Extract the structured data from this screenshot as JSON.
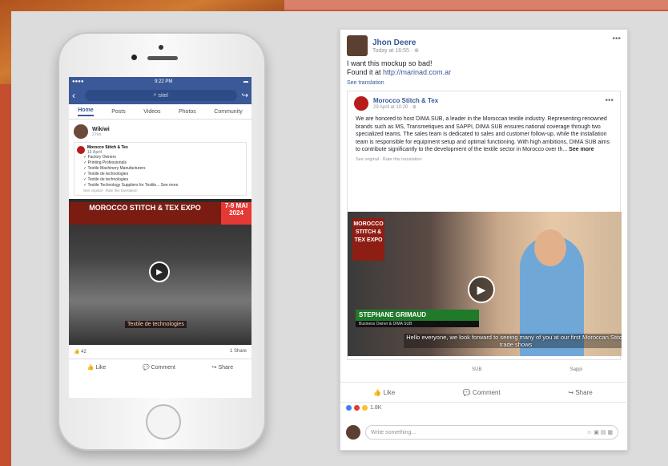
{
  "phone": {
    "status_time": "9:22 PM",
    "search_text": "sitel",
    "tabs": [
      "Home",
      "Posts",
      "Videos",
      "Photos",
      "Community"
    ],
    "post_author": "Wikiwi",
    "post_time": "2 hrs",
    "shared_author": "Morocco Stitch & Tex",
    "shared_time": "15 April",
    "list": [
      "Factory Owners",
      "Printing Professionals",
      "Textile Machinery Manufacturers",
      "Textile de technologies",
      "Textile de technologies",
      "Textile Technology Suppliers for Textile... See more"
    ],
    "see_original": "See original · Rate this translation",
    "video_banner": "MOROCCO STITCH & TEX EXPO",
    "video_date": "7-9 MAI 2024",
    "caption": "Textile de technologies",
    "likes": "42",
    "shares": "1 Share",
    "actions": [
      "Like",
      "Comment",
      "Share"
    ]
  },
  "desktop": {
    "author": "Jhon Deere",
    "time": "Today at 16:55 · ",
    "text_line1": "I want this mockup so bad!",
    "text_line2_prefix": "Found it at ",
    "text_link": "http://marinad.com.ar",
    "see_translation": "See translation",
    "shared_author": "Morocco Stitch & Tex",
    "shared_time": "29 April at 10:20 · ",
    "shared_body": "We are honored to host DIMA SUB, a leader in the Moroccan textile industry. Representing renowned brands such as MS, Transmetiques and SAPPI, DIMA SUB ensures national coverage through two specialized teams. The sales team is dedicated to sales and customer follow-up, while the installation team is responsible for equipment setup and optimal functioning. With high ambitions, DIMA SUB aims to contribute significantly to the development of the textile sector in Morocco over th...",
    "see_more": "See more",
    "see_original": "See original · Rate this translation",
    "video_badge": "MOROCCO STITCH & TEX EXPO",
    "name_bar": "STEPHANE GRIMAUD",
    "name_sub": "Business Owner & DIMA SUB",
    "subtitle": "Hello everyone, we look forward to seeing many of you at our first Moroccan Stitch trade shows",
    "logos": [
      "",
      "SUB",
      "Sappi"
    ],
    "actions": [
      "Like",
      "Comment",
      "Share"
    ],
    "reactions_count": "1.8K",
    "comment_placeholder": "Write something..."
  }
}
